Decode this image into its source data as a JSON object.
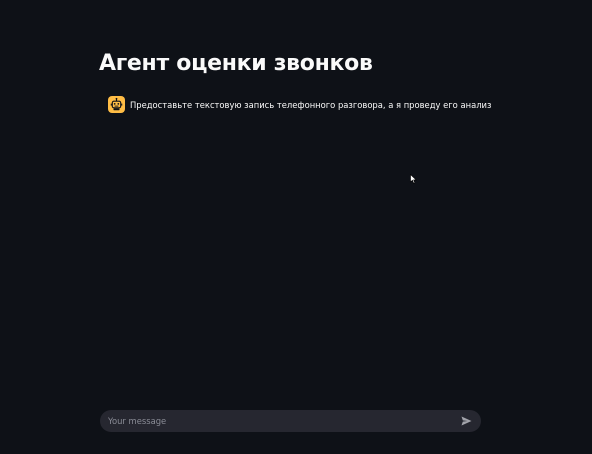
{
  "header": {
    "title": "Агент оценки звонков"
  },
  "chat": {
    "messages": [
      {
        "role": "assistant",
        "avatar_icon": "robot-icon",
        "avatar_color": "#ffbd45",
        "text": "Предоставьте текстовую запись телефонного разговора, а я проведу его анализ"
      }
    ]
  },
  "input": {
    "placeholder": "Your message",
    "value": "",
    "send_icon": "send-icon"
  },
  "colors": {
    "background": "#0e1117",
    "input_background": "#262730",
    "text": "#fafafa",
    "avatar": "#ffbd45"
  }
}
